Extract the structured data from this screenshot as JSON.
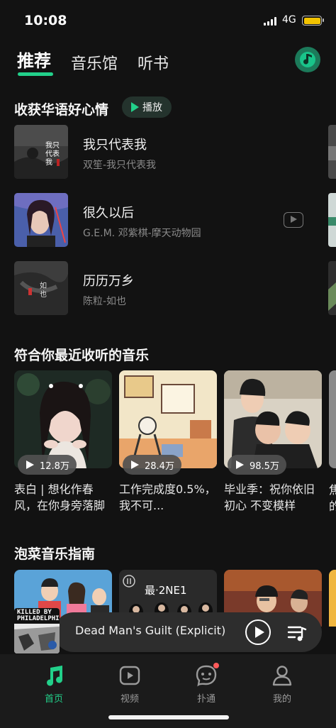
{
  "status": {
    "time": "10:08",
    "network": "4G"
  },
  "tabs": [
    {
      "label": "推荐",
      "active": true
    },
    {
      "label": "音乐馆",
      "active": false
    },
    {
      "label": "听书",
      "active": false
    }
  ],
  "section1": {
    "title": "收获华语好心情",
    "play_label": "播放"
  },
  "songs": [
    {
      "title": "我只代表我",
      "subtitle": "双笙-我只代表我",
      "cover_text": "我只代表我"
    },
    {
      "title": "很久以后",
      "subtitle": "G.E.M. 邓紫棋-摩天动物园"
    },
    {
      "title": "历历万乡",
      "subtitle": "陈粒-如也",
      "cover_text": "如也"
    }
  ],
  "section2": {
    "title": "符合你最近收听的音乐"
  },
  "playlists": [
    {
      "count": "12.8万",
      "desc": "表白 | 想化作春风，在你身旁落脚"
    },
    {
      "count": "28.4万",
      "desc": "工作完成度0.5%，我不可..."
    },
    {
      "count": "98.5万",
      "desc": "毕业季：祝你依旧初心 不变模样"
    }
  ],
  "partial_card": {
    "count": "",
    "desc": "焦的"
  },
  "section3": {
    "title": "泡菜音乐指南"
  },
  "guide": [
    {
      "text": ""
    },
    {
      "text": "最·2NE1"
    },
    {
      "text": ""
    }
  ],
  "player": {
    "track": "Dead Man's Guilt (Explicit)",
    "cover_text": "KILLED BY PHILADELPHIA"
  },
  "nav": [
    {
      "label": "首页",
      "active": true,
      "icon": "music-note-icon"
    },
    {
      "label": "视频",
      "active": false,
      "icon": "video-play-icon"
    },
    {
      "label": "扑通",
      "active": false,
      "icon": "chat-face-icon",
      "badge": true
    },
    {
      "label": "我的",
      "active": false,
      "icon": "profile-icon"
    }
  ],
  "colors": {
    "accent": "#22d08a",
    "background": "#121212",
    "subtext": "#8a8a8a"
  }
}
